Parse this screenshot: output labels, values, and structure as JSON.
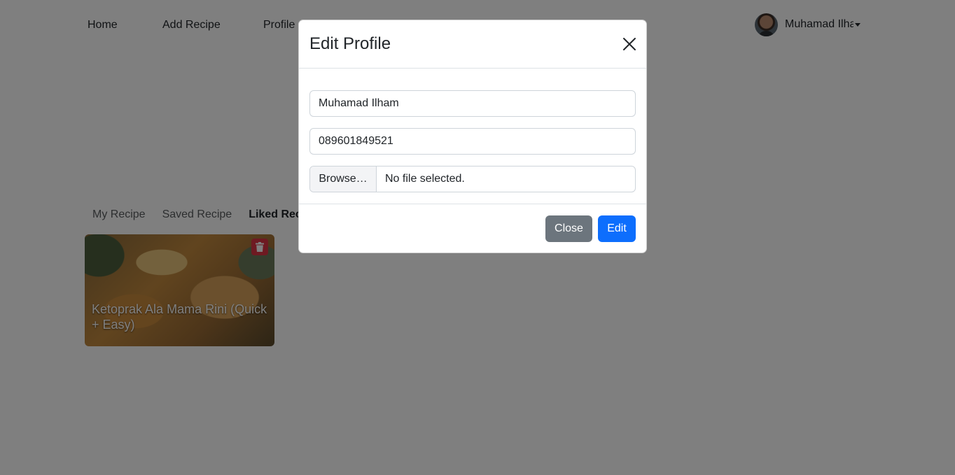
{
  "nav": {
    "items": [
      {
        "label": "Home"
      },
      {
        "label": "Add Recipe"
      },
      {
        "label": "Profile"
      }
    ],
    "user": {
      "name": "Muhamad Ilham"
    }
  },
  "tabs": [
    {
      "label": "My Recipe"
    },
    {
      "label": "Saved Recipe"
    },
    {
      "label": "Liked Recipe",
      "active": true
    }
  ],
  "recipes": [
    {
      "title": "Ketoprak Ala Mama Rini (Quick + Easy)"
    }
  ],
  "modal": {
    "title": "Edit Profile",
    "name_value": "Muhamad Ilham",
    "phone_value": "089601849521",
    "browse_label": "Browse…",
    "file_status": "No file selected.",
    "close_label": "Close",
    "edit_label": "Edit"
  },
  "colors": {
    "primary": "#0d6efd",
    "secondary": "#6c757d",
    "danger": "#dc3545"
  }
}
